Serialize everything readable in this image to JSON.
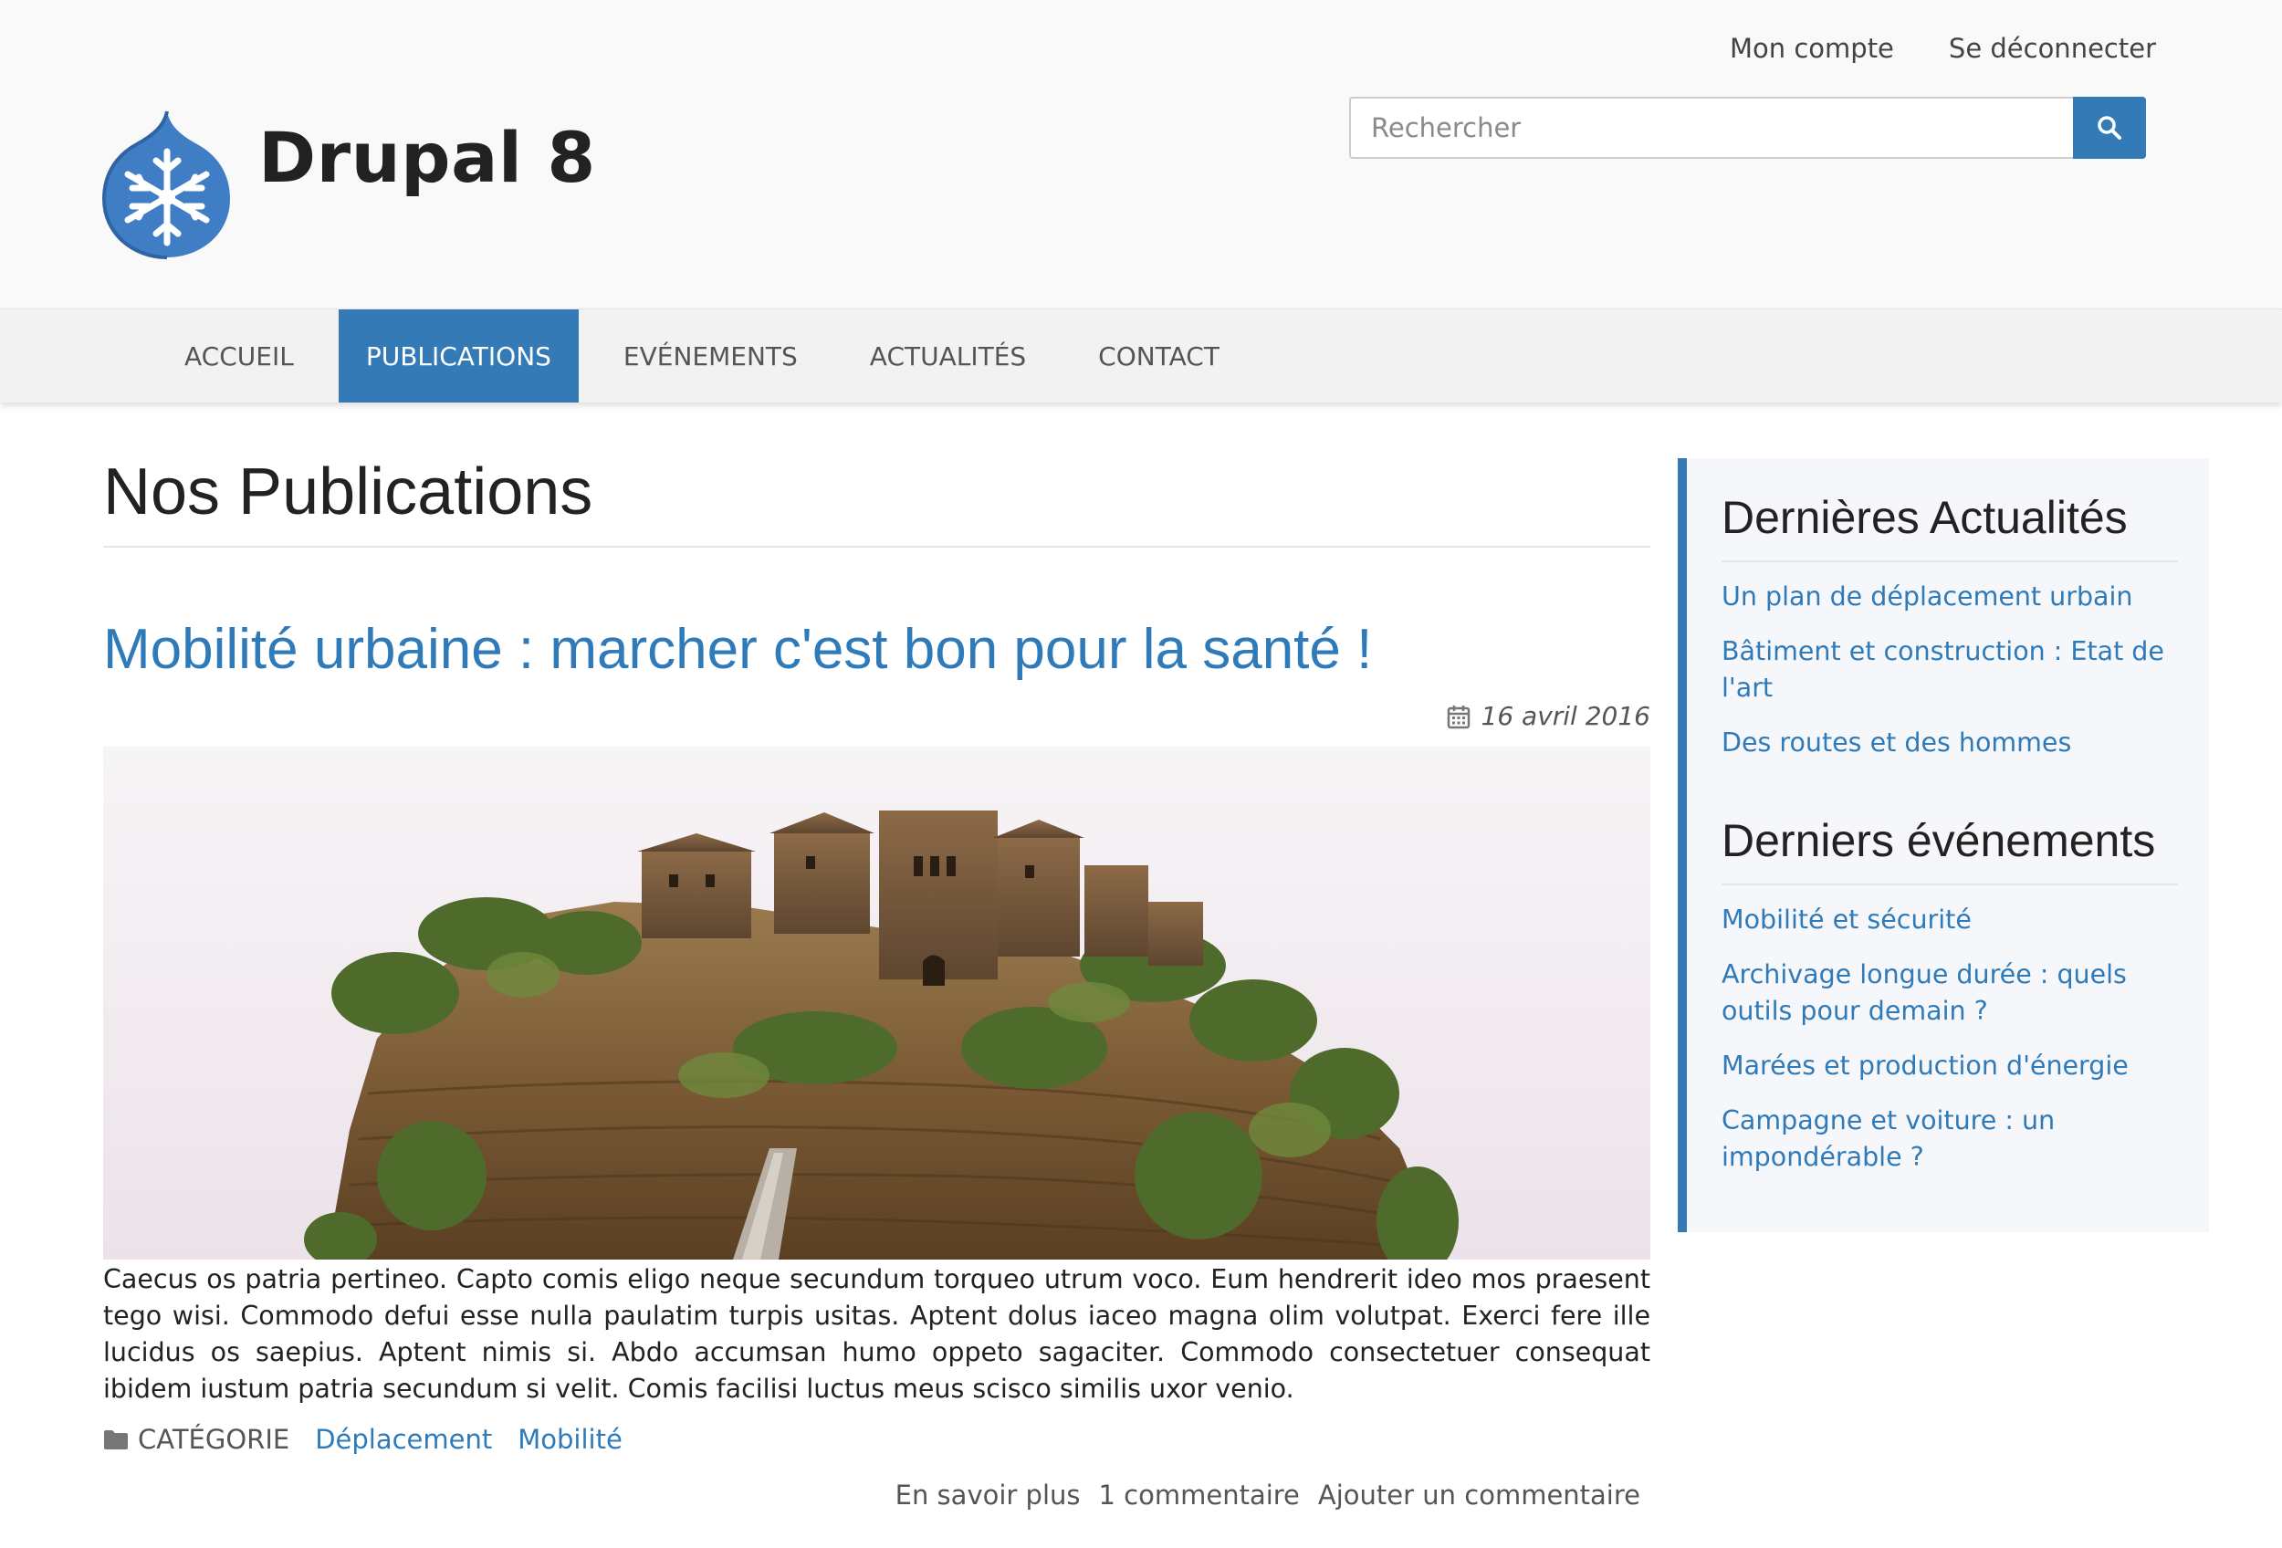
{
  "header": {
    "site_name": "Drupal 8",
    "user_links": [
      "Mon compte",
      "Se déconnecter"
    ],
    "search": {
      "placeholder": "Rechercher",
      "button_icon": "search-icon"
    }
  },
  "nav": {
    "items": [
      {
        "label": "ACCUEIL",
        "active": false
      },
      {
        "label": "PUBLICATIONS",
        "active": true
      },
      {
        "label": "EVÉNEMENTS",
        "active": false
      },
      {
        "label": "ACTUALITÉS",
        "active": false
      },
      {
        "label": "CONTACT",
        "active": false
      }
    ]
  },
  "main": {
    "page_title": "Nos Publications",
    "article": {
      "title": "Mobilité urbaine : marcher c'est bon pour la santé !",
      "date": "16 avril 2016",
      "date_icon": "calendar-icon",
      "body": "Caecus os patria pertineo. Capto comis eligo neque secundum torqueo utrum voco. Eum hendrerit ideo mos praesent tego wisi. Commodo defui esse nulla paulatim turpis usitas. Aptent dolus iaceo magna olim volutpat. Exerci fere ille lucidus os saepius. Aptent nimis si. Abdo accumsan humo oppeto sagaciter. Commodo consectetuer consequat ibidem iustum patria secundum si velit. Comis facilisi luctus meus scisco similis uxor venio.",
      "category_icon": "folder-icon",
      "category_label": "CATÉGORIE",
      "tags": [
        "Déplacement",
        "Mobilité"
      ],
      "links": [
        "En savoir plus",
        "1 commentaire",
        "Ajouter un commentaire"
      ]
    }
  },
  "sidebar": {
    "news": {
      "title": "Dernières Actualités",
      "items": [
        "Un plan de déplacement urbain",
        "Bâtiment et construction : Etat de l'art",
        "Des routes et des hommes"
      ]
    },
    "events": {
      "title": "Derniers événements",
      "items": [
        "Mobilité et sécurité",
        "Archivage longue durée : quels outils pour demain ?",
        "Marées et production d'énergie",
        "Campagne et voiture : un impondérable ?"
      ]
    }
  },
  "colors": {
    "accent": "#337ab7",
    "link": "#2f7ab9",
    "header_bg": "#f9f9f9",
    "nav_bg": "#f2f2f2",
    "sidebar_bg": "#f5f7fa"
  }
}
